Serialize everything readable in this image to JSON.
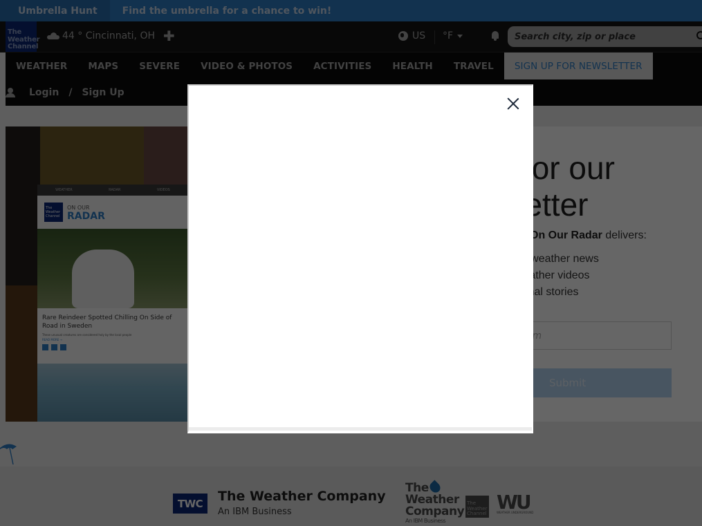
{
  "promo": {
    "tag": "Umbrella Hunt",
    "message": "Find the umbrella for a chance to win!"
  },
  "header": {
    "logo_lines": [
      "The",
      "Weather",
      "Channel"
    ],
    "location": "44 ° Cincinnati, OH",
    "weather_icon": "cloud-icon",
    "add_location_icon": "plus-icon",
    "region": "US",
    "unit": "°F",
    "search_placeholder": "Search city, zip or place"
  },
  "nav": {
    "items": [
      "WEATHER",
      "MAPS",
      "SEVERE",
      "VIDEO & PHOTOS",
      "ACTIVITIES",
      "HEALTH",
      "TRAVEL"
    ],
    "cta": "SIGN UP FOR NEWSLETTER"
  },
  "account": {
    "login": "Login",
    "separator": "/",
    "signup": "Sign Up"
  },
  "hero": {
    "phone_tabs": [
      "WEATHER",
      "RADAR",
      "VIDEOS"
    ],
    "phone_logo": "The Weather Channel",
    "phone_kicker": "ON OUR",
    "phone_title": "RADAR",
    "article_title": "Rare Reindeer Spotted Chilling On Side of Road in Sweden",
    "article_sub": "These unusual creatures are considered holy by the local people",
    "read_more": "READ MORE →"
  },
  "signup": {
    "title": "up for our wsletter",
    "title_line1": "up for our",
    "title_line2": "wsletter",
    "lead_bold": "On Our Radar",
    "lead_rest": " delivers:",
    "bullets": [
      "y latest weather news",
      "lible weather videos",
      "spirational stories"
    ],
    "email_placeholder": "ldress.com",
    "submit": "Submit"
  },
  "footer": {
    "badge": "TWC",
    "company": "The Weather Company",
    "tagline": "An IBM Business",
    "wordmark_lines": [
      "The",
      "Weather",
      "Company"
    ],
    "wordmark_sub": "An IBM Business",
    "tv_logo_lines": [
      "The",
      "Weather",
      "Channel"
    ],
    "wu_logo": "WU",
    "wu_sub": "WEATHER UNDERGROUND"
  },
  "modal": {
    "close_icon": "close-icon"
  },
  "colors": {
    "brand_blue": "#2f7ec6",
    "logo_navy": "#0a2775",
    "overlay": "rgba(0,0,0,0.6)"
  }
}
